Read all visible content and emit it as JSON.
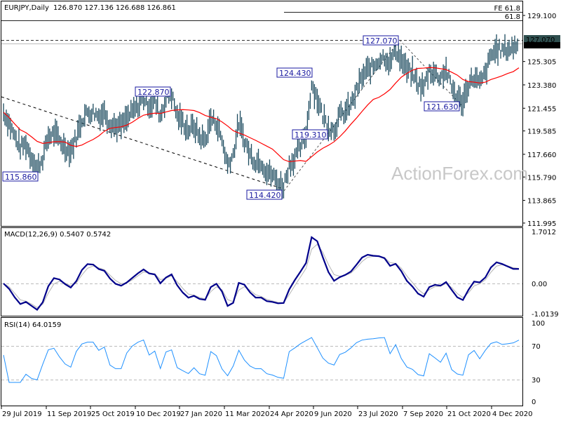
{
  "header": {
    "symbol_tf": "EURJPY,Daily",
    "ohlc": "126.870 127.136 126.688 126.861"
  },
  "watermark": "ActionForex.com",
  "colors": {
    "bars": "#1b4a5e",
    "ma": "#ff0000",
    "macd": "#00008b",
    "signal": "#b4b4b4",
    "rsi": "#1e90ff",
    "annotation": "#1a1aa0"
  },
  "chart_data": {
    "type": "bar",
    "title": "EURJPY,Daily",
    "price_axis": {
      "ticks": [
        "129.100",
        "125.305",
        "123.380",
        "121.455",
        "119.585",
        "117.660",
        "115.790",
        "113.865",
        "111.995"
      ],
      "range": [
        111.995,
        129.1
      ]
    },
    "current_price_label": "127.070",
    "close_label": "126.861",
    "x_ticks": [
      "29 Jul 2019",
      "11 Sep 2019",
      "25 Oct 2019",
      "10 Dec 2019",
      "27 Jan 2020",
      "11 Mar 2020",
      "24 Apr 2020",
      "9 Jun 2020",
      "23 Jul 2020",
      "7 Sep 2020",
      "21 Oct 2020",
      "4 Dec 2020"
    ],
    "closes": [
      121.12,
      120.26,
      119.1,
      118.23,
      118.52,
      117.37,
      116.5,
      117.37,
      119.1,
      119.39,
      118.81,
      118.23,
      117.94,
      119.1,
      120.55,
      121.12,
      121.12,
      120.83,
      121.12,
      120.26,
      119.97,
      119.97,
      120.55,
      121.12,
      121.7,
      122.28,
      121.7,
      121.99,
      120.83,
      122.28,
      122.57,
      120.83,
      120.26,
      119.68,
      119.97,
      119.1,
      118.81,
      120.55,
      120.26,
      118.81,
      116.79,
      117.65,
      120.26,
      118.81,
      117.65,
      117.08,
      117.08,
      116.21,
      115.92,
      115.34,
      115.05,
      116.79,
      117.37,
      118.23,
      119.39,
      123.44,
      122.28,
      120.83,
      119.97,
      119.68,
      120.83,
      121.12,
      121.7,
      122.86,
      124.01,
      124.59,
      124.88,
      125.46,
      125.75,
      125.17,
      126.33,
      125.46,
      124.59,
      124.3,
      123.44,
      123.15,
      124.59,
      124.3,
      124.01,
      124.59,
      123.15,
      122.28,
      121.99,
      123.44,
      124.01,
      123.44,
      124.3,
      125.75,
      126.33,
      126.21,
      126.33,
      126.44,
      126.9
    ],
    "annotations": [
      {
        "label": "115.860",
        "price": 115.86
      },
      {
        "label": "122.870",
        "price": 122.87
      },
      {
        "label": "124.430",
        "price": 124.43
      },
      {
        "label": "119.310",
        "price": 119.31
      },
      {
        "label": "114.420",
        "price": 114.42
      },
      {
        "label": "127.070",
        "price": 127.07
      },
      {
        "label": "121.630",
        "price": 121.63
      }
    ],
    "fib_labels": {
      "fe": "FE 61.8",
      "retr": "61.8"
    },
    "macd": {
      "title": "MACD(12,26,9) 0.5407 0.5742",
      "ticks": [
        "1.7012",
        "0.00",
        "-1.0139"
      ],
      "range": [
        -1.0139,
        1.7012
      ]
    },
    "rsi": {
      "title": "RSI(14) 64.0159",
      "ticks": [
        "100",
        "70",
        "30",
        "0"
      ],
      "range": [
        0,
        100
      ]
    }
  }
}
